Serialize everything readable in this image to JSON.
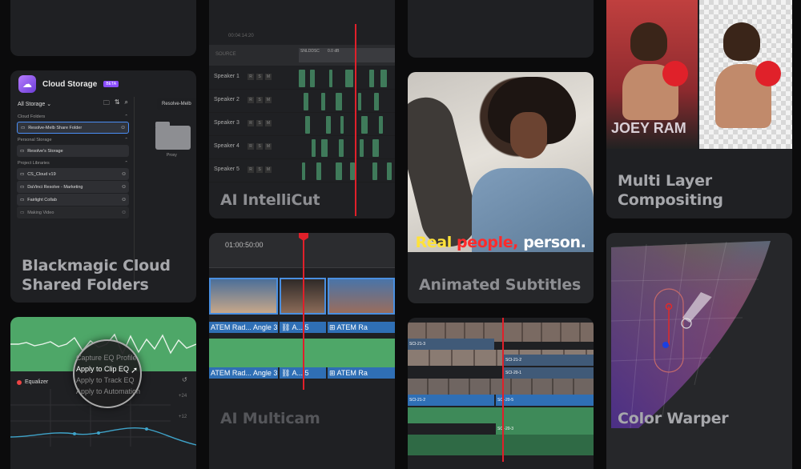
{
  "cloud_storage": {
    "title": "Cloud Storage",
    "badge": "BETA",
    "dropdown": "All Storage",
    "sections": [
      {
        "label": "Cloud Folders",
        "items": [
          "Resolve-Melb Share Folder"
        ]
      },
      {
        "label": "Personal Storage",
        "items": [
          "Resolve's Storage"
        ]
      },
      {
        "label": "Project Libraries",
        "items": [
          "CS_Cloud v19",
          "DaVinci Resolve - Marketing",
          "Fairlight Collab",
          "Making Video"
        ]
      }
    ],
    "tab": "Resolve-Melb",
    "folder_label": "Proxy",
    "card_title": [
      "Blackmagic Cloud",
      "Shared Folders"
    ]
  },
  "eq": {
    "equalizer_label": "Equalizer",
    "menu": [
      "Capture EQ Profile",
      "Apply to Clip EQ",
      "Apply to Track EQ",
      "Apply to Automation"
    ],
    "scale": [
      "+24",
      "+12"
    ]
  },
  "intellicut": {
    "timecodes": [
      "00:04:14:20"
    ],
    "source_label": "SOURCE",
    "clip_name": "SNLDDSC",
    "clip_db": "0.0 dB",
    "tracks": [
      "Speaker 1",
      "Speaker 2",
      "Speaker 3",
      "Speaker 4",
      "Speaker 5"
    ],
    "rsm": [
      "R",
      "S",
      "M"
    ],
    "card_title": "AI IntelliCut"
  },
  "multicam": {
    "timecode": "01:00:50:00",
    "labels_top": [
      "ATEM Rad... Angle 3",
      "A... 5",
      "ATEM Ra"
    ],
    "labels_bottom": [
      "ATEM Rad... Angle 3",
      "A... 5",
      "ATEM Ra"
    ],
    "card_title": "AI Multicam"
  },
  "subtitles": {
    "words": [
      {
        "text": "Real ",
        "color": "#ffe23a"
      },
      {
        "text": "people, ",
        "color": "#ff2b2b"
      },
      {
        "text": "person.",
        "color": "#ffffff"
      }
    ],
    "card_title": "Animated Subtitles"
  },
  "compositing": {
    "poster_text": "JOEY RAM",
    "card_title": [
      "Multi Layer",
      "Compositing"
    ]
  },
  "edit_timeline": {
    "clips": [
      "SCI-21-3",
      "SCI-21-2",
      "SCI-20-1",
      "SCI-21-2",
      "SCI-20-5",
      "SCI-20-3"
    ]
  },
  "color_warper": {
    "card_title": "Color Warper"
  }
}
